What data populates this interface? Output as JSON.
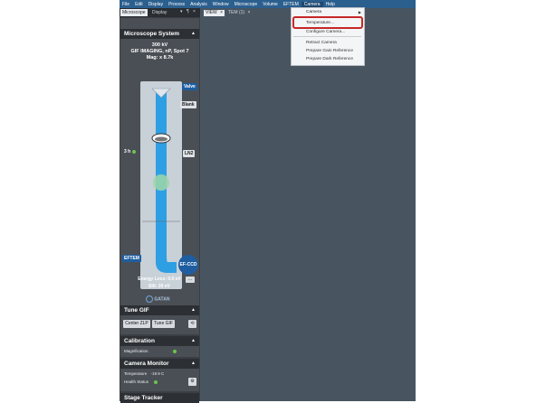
{
  "menubar": {
    "items": [
      "File",
      "Edit",
      "Display",
      "Process",
      "Analysis",
      "Window",
      "Microscope",
      "Volume",
      "EFTEM",
      "Camera",
      "Help"
    ],
    "open_item": "Camera"
  },
  "panel": {
    "tabs": [
      "Microscope",
      "Display"
    ],
    "controls": [
      "▾",
      "¶",
      "×"
    ],
    "microscope_system": {
      "title": "Microscope System",
      "kv": "300 kV",
      "mode": "GIF IMAGING, nP, Spot 7",
      "mag": "Mag: x 8.7k",
      "labels": {
        "valve": "Valve",
        "blank": "Blank",
        "ln2": "LN2",
        "eftem": "EFTEM",
        "efccd": "EF-CCD",
        "time": "3 h"
      },
      "energy_loss": "Energy Loss: 0.0 eV",
      "slit": "Slit: 20 eV",
      "more": "...",
      "logo": "GATAN"
    },
    "tune_gif": {
      "title": "Tune GIF",
      "center_zlp": "Center ZLP",
      "tune_gif_btn": "Tune GIF"
    },
    "calibration": {
      "title": "Calibration",
      "magnification": "Magnification"
    },
    "camera_monitor": {
      "title": "Camera Monitor",
      "temperature_label": "Temperature",
      "temperature_value": "-19.9 C",
      "health_label": "Health Status"
    },
    "stage_tracker": {
      "title": "Stage Tracker"
    }
  },
  "doc_tabs": [
    {
      "label": "VIEW",
      "close": "×"
    },
    {
      "label": "TEM (1)",
      "close": "×"
    }
  ],
  "camera_menu": {
    "header": "Camera",
    "items": [
      "Temperature...",
      "Configure Camera...",
      "Retract Camera",
      "Prepare Gain Reference",
      "Prepare Dark Reference"
    ],
    "highlighted": "Temperature..."
  },
  "colors": {
    "menubar": "#2b5f8e",
    "workspace": "#485561",
    "beam": "#2f9fe4",
    "highlight": "#c62828"
  }
}
